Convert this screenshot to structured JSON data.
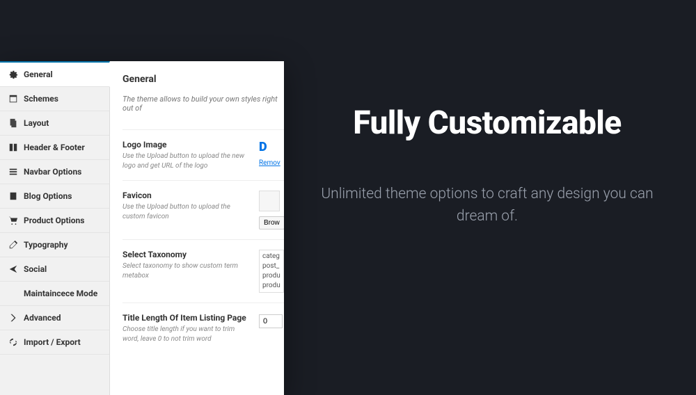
{
  "hero": {
    "title": "Fully Customizable",
    "subtitle": "Unlimited theme options to craft any design you can dream of."
  },
  "sidebar": {
    "items": [
      {
        "label": "General",
        "icon": "gear"
      },
      {
        "label": "Schemes",
        "icon": "window"
      },
      {
        "label": "Layout",
        "icon": "pages"
      },
      {
        "label": "Header & Footer",
        "icon": "columns"
      },
      {
        "label": "Navbar Options",
        "icon": "menu"
      },
      {
        "label": "Blog Options",
        "icon": "book"
      },
      {
        "label": "Product Options",
        "icon": "cart"
      },
      {
        "label": "Typography",
        "icon": "edit"
      },
      {
        "label": "Social",
        "icon": "share"
      },
      {
        "label": "Maintaincece Mode",
        "icon": "tools"
      },
      {
        "label": "Advanced",
        "icon": "chevron"
      },
      {
        "label": "Import / Export",
        "icon": "refresh"
      }
    ]
  },
  "main": {
    "heading": "General",
    "intro": "The theme allows to build your own styles right out of",
    "fields": {
      "logo": {
        "title": "Logo Image",
        "desc": "Use the Upload button to upload the new logo and get URL of the logo",
        "preview": "D",
        "remove": "Remov"
      },
      "favicon": {
        "title": "Favicon",
        "desc": "Use the Upload button to upload the custom favicon",
        "button": "Brow"
      },
      "taxonomy": {
        "title": "Select Taxonomy",
        "desc": "Select taxonomy to show custom term metabox",
        "options": [
          "categ",
          "post_",
          "produ",
          "produ"
        ]
      },
      "titlelen": {
        "title": "Title Length Of Item Listing Page",
        "desc": "Choose title length if you want to trim word, leave 0 to not trim word",
        "value": "0"
      }
    }
  }
}
